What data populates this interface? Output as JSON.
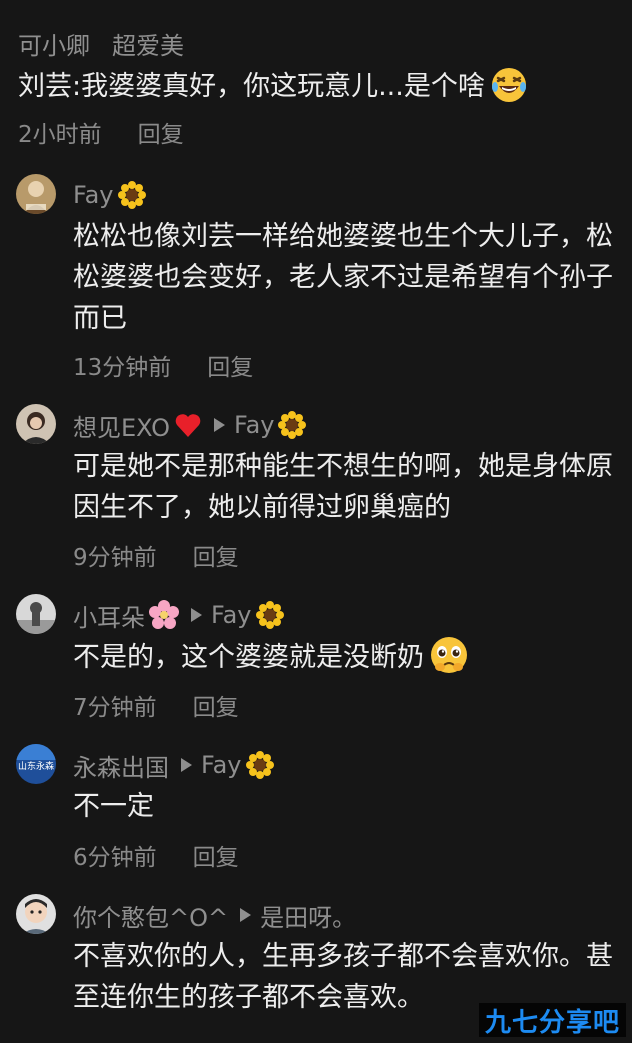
{
  "comments": [
    {
      "username": "可小卿",
      "reply_to": "",
      "badge": "超爱美",
      "text": "刘芸:我婆婆真好，你这玩意儿...是个啥",
      "emoji": "laughing-tears-emoji",
      "time": "2小时前",
      "reply_label": "回复"
    },
    {
      "username": "Fay",
      "name_emoji": "sunflower-emoji",
      "reply_to": "",
      "text": "松松也像刘芸一样给她婆婆也生个大儿子，松松婆婆也会变好，老人家不过是希望有个孙子而已",
      "time": "13分钟前",
      "reply_label": "回复"
    },
    {
      "username": "想见EXO",
      "name_emoji": "red-heart-emoji",
      "reply_to": "Fay",
      "reply_to_emoji": "sunflower-emoji",
      "text": "可是她不是那种能生不想生的啊，她是身体原因生不了，她以前得过卵巢癌的",
      "time": "9分钟前",
      "reply_label": "回复"
    },
    {
      "username": "小耳朵",
      "name_emoji": "cherry-blossom-emoji",
      "reply_to": "Fay",
      "reply_to_emoji": "sunflower-emoji",
      "text": "不是的，这个婆婆就是没断奶",
      "emoji": "pleading-face-emoji",
      "time": "7分钟前",
      "reply_label": "回复"
    },
    {
      "username": "永森出国",
      "avatar_text": "山东永森",
      "reply_to": "Fay",
      "reply_to_emoji": "sunflower-emoji",
      "text": "不一定",
      "time": "6分钟前",
      "reply_label": "回复"
    },
    {
      "username": "你个憨包^O^",
      "reply_to": "是田呀。",
      "text": "不喜欢你的人，生再多孩子都不会喜欢你。甚至连你生的孩子都不会喜欢。"
    }
  ],
  "watermark": "九七分享吧",
  "colors": {
    "background": "#161616",
    "text_primary": "#ededed",
    "text_secondary": "#8f8f8f",
    "watermark": "#1d8bf2"
  }
}
